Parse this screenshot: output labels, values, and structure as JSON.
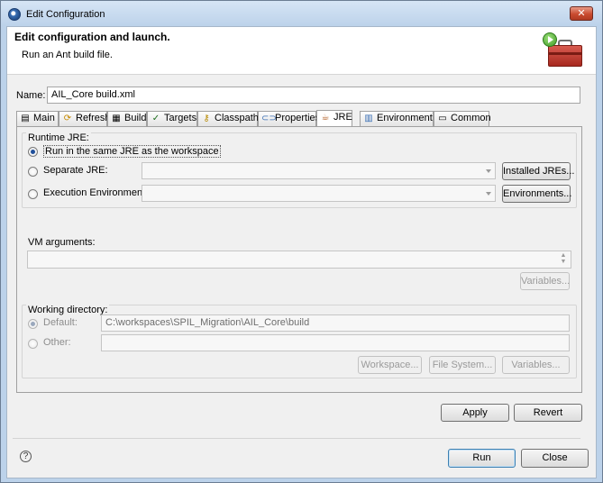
{
  "window": {
    "title": "Edit Configuration",
    "close": "✕"
  },
  "header": {
    "title": "Edit configuration and launch.",
    "description": "Run an Ant build file."
  },
  "name": {
    "label": "Name:",
    "value": "AIL_Core build.xml"
  },
  "tabs": [
    {
      "label": "Main",
      "icon": "main-icon"
    },
    {
      "label": "Refresh",
      "icon": "refresh-icon"
    },
    {
      "label": "Build",
      "icon": "build-icon"
    },
    {
      "label": "Targets",
      "icon": "targets-icon"
    },
    {
      "label": "Classpath",
      "icon": "classpath-icon"
    },
    {
      "label": "Properties",
      "icon": "properties-icon"
    },
    {
      "label": "JRE",
      "icon": "jre-icon"
    },
    {
      "label": "Environment",
      "icon": "environment-icon"
    },
    {
      "label": "Common",
      "icon": "common-icon"
    }
  ],
  "runtime_jre": {
    "group_label": "Runtime JRE:",
    "same_jre_label": "Run in the same JRE as the workspace",
    "separate_jre_label": "Separate JRE:",
    "installed_jres_button": "Installed JREs...",
    "exec_env_label": "Execution Environment:",
    "environments_button": "Environments..."
  },
  "vm_arguments": {
    "label": "VM arguments:",
    "value": "",
    "variables_button": "Variables..."
  },
  "working_directory": {
    "group_label": "Working directory:",
    "default_label": "Default:",
    "default_value": "C:\\workspaces\\SPIL_Migration\\AIL_Core\\build",
    "other_label": "Other:",
    "other_value": "",
    "workspace_button": "Workspace...",
    "file_system_button": "File System...",
    "variables_button": "Variables..."
  },
  "actions": {
    "apply": "Apply",
    "revert": "Revert",
    "run": "Run",
    "close": "Close",
    "help": "?"
  }
}
